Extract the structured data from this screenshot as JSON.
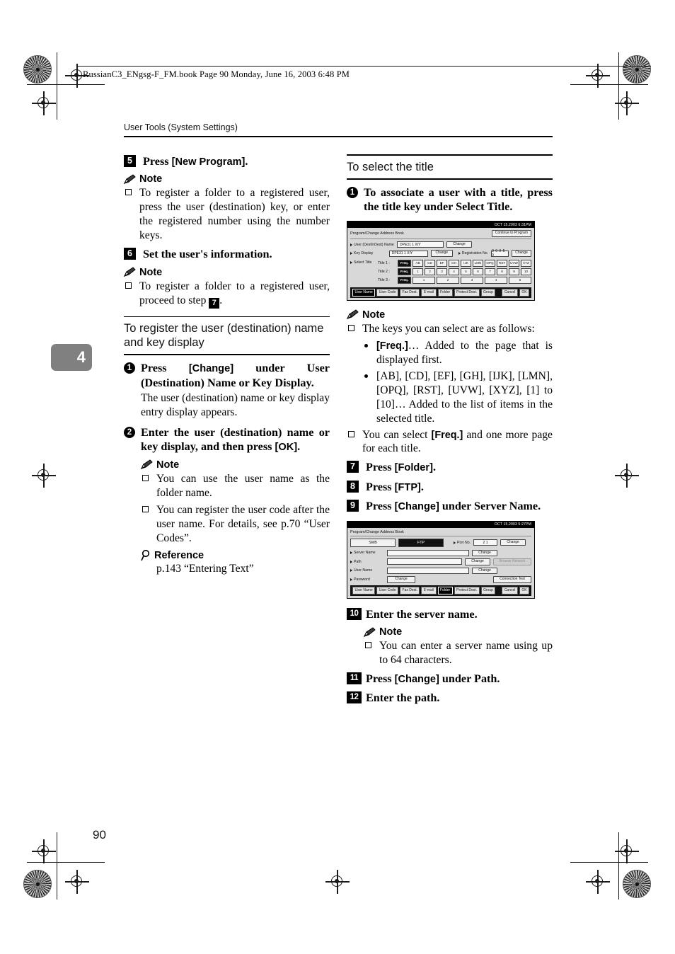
{
  "print_header": {
    "file_line": "RussianC3_ENgsg-F_FM.book  Page 90  Monday, June 16, 2003  6:48 PM"
  },
  "running_head": "User Tools (System Settings)",
  "chapter_tab": "4",
  "folio": "90",
  "left_column": {
    "step5": {
      "num": "5",
      "text_before": "Press ",
      "key": "[New Program]",
      "text_after": ".",
      "note_label": "Note",
      "note_items": [
        "To register a folder to a registered user, press the user (destination) key, or enter the registered number using the number keys."
      ]
    },
    "step6": {
      "num": "6",
      "text": "Set the user's information.",
      "note_label": "Note",
      "note_prefix": "To register a folder to a registered user, proceed to step ",
      "note_step_ref": "7",
      "note_suffix": "."
    },
    "section": {
      "title": "To register the user (destination) name and key display"
    },
    "substep1": {
      "num": "1",
      "text_a": "Press ",
      "key": "[Change]",
      "text_b": " under User (Destination) Name or Key Display.",
      "body": "The user (destination) name or key display entry display appears."
    },
    "substep2": {
      "num": "2",
      "text_a": "Enter the user (destination) name or key display, and then press ",
      "key": "[OK]",
      "text_b": ".",
      "note_label": "Note",
      "note_items": [
        "You can use the user name as the folder name.",
        "You can register the user code after the user name. For details, see p.70 “User Codes”."
      ],
      "reference_label": "Reference",
      "reference_body": "p.143 “Entering Text”"
    }
  },
  "right_column": {
    "section": {
      "title": "To select the title"
    },
    "substep1": {
      "num": "1",
      "text": "To associate a user with a title, press the title key under Select Title."
    },
    "figure1": {
      "status_time": "OCT  15.2003  6:31PM",
      "window_title": "Program/Change Address Book",
      "continue_button": "Continue to Program",
      "rows": [
        {
          "label": "User (Dest/nDest) Name",
          "value": "DPE31 1  XIY",
          "button": "Change"
        },
        {
          "label": "Key Display",
          "value": "DPE31 1  XIY",
          "button": "Change"
        }
      ],
      "reg_no_label": "Registration No.",
      "reg_no_value": "0 0 0 5 0",
      "reg_no_button": "Change",
      "select_title_label": "Select Title",
      "title_rows": [
        {
          "label": "Title 1 :",
          "freq": "Freq.",
          "keys": [
            "AB",
            "CD",
            "EF",
            "GH",
            "IJK",
            "LMN",
            "OPQ",
            "RST",
            "UVW",
            "XYZ"
          ]
        },
        {
          "label": "Title 2 :",
          "freq": "Freq.",
          "keys": [
            "1",
            "2",
            "3",
            "4",
            "5",
            "6",
            "7",
            "8",
            "9",
            "10"
          ]
        },
        {
          "label": "Title 3 :",
          "freq": "Freq.",
          "keys": [
            "1",
            "2",
            "3",
            "4",
            "5"
          ]
        }
      ],
      "tabs": [
        "User Name",
        "User Code",
        "Fax Dest.",
        "E-mail",
        "Folder",
        "Protect Dest.",
        "Group"
      ],
      "selected_tab": "User Name",
      "cancel_button": "Cancel",
      "ok_button": "OK"
    },
    "note1": {
      "label": "Note",
      "intro": "The keys you can select are as follows:",
      "bullets": [
        {
          "key": "[Freq.]",
          "text": "… Added to the page that is displayed first."
        },
        {
          "key": "",
          "text": "[AB], [CD], [EF], [GH], [IJK], [LMN], [OPQ], [RST], [UVW], [XYZ], [1] to [10]… Added to the list of items in the selected title."
        }
      ],
      "last_a": "You can select ",
      "last_key": "[Freq.]",
      "last_b": " and one more page for each title."
    },
    "step7": {
      "num": "7",
      "text_a": "Press ",
      "key": "[Folder]",
      "text_b": "."
    },
    "step8": {
      "num": "8",
      "text_a": "Press ",
      "key": "[FTP]",
      "text_b": "."
    },
    "step9": {
      "num": "9",
      "text_a": "Press ",
      "key": "[Change]",
      "text_b": " under Server Name."
    },
    "figure2": {
      "status_time": "OCT  15.2003  5:27PM",
      "window_title": "Program/Change Address Book",
      "modes": [
        "SMB",
        "FTP"
      ],
      "selected_mode": "FTP",
      "port_label": "Port No.",
      "port_value": "2 1",
      "port_button": "Change",
      "rows": [
        {
          "label": "Server Name",
          "value": "",
          "button": "Change",
          "extra": ""
        },
        {
          "label": "Path",
          "value": "",
          "button": "Change",
          "extra": "Browse Network"
        },
        {
          "label": "User Name",
          "value": "",
          "button": "Change",
          "extra": ""
        }
      ],
      "password_label": "Password",
      "password_button": "Change",
      "connection_test_button": "Connection Test",
      "tabs": [
        "User Name",
        "User Code",
        "Fax Dest.",
        "E-mail",
        "Folder",
        "Protect Dest.",
        "Group"
      ],
      "selected_tab": "Folder",
      "cancel_button": "Cancel",
      "ok_button": "OK"
    },
    "step10": {
      "num": "10",
      "text": "Enter the server name.",
      "note_label": "Note",
      "note_items": [
        "You can enter a server name using up to 64 characters."
      ]
    },
    "step11": {
      "num": "11",
      "text_a": "Press ",
      "key": "[Change]",
      "text_b": " under Path."
    },
    "step12": {
      "num": "12",
      "text": "Enter the path."
    }
  }
}
